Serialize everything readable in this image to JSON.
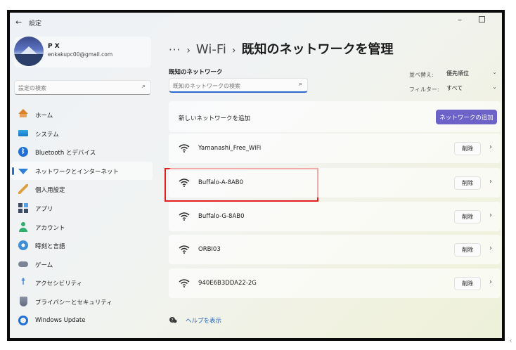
{
  "window": {
    "title": "設定",
    "back_icon": "back-arrow-icon"
  },
  "profile": {
    "name": "P X",
    "email": "enkakupc00@gmail.com"
  },
  "sidebar_search": {
    "placeholder": "設定の検索"
  },
  "nav": {
    "items": [
      {
        "label": "ホーム",
        "icon": "home-icon"
      },
      {
        "label": "システム",
        "icon": "system-icon"
      },
      {
        "label": "Bluetooth とデバイス",
        "icon": "bluetooth-icon"
      },
      {
        "label": "ネットワークとインターネット",
        "icon": "network-icon",
        "selected": true
      },
      {
        "label": "個人用設定",
        "icon": "brush-icon"
      },
      {
        "label": "アプリ",
        "icon": "apps-icon"
      },
      {
        "label": "アカウント",
        "icon": "account-icon"
      },
      {
        "label": "時刻と言語",
        "icon": "time-language-icon"
      },
      {
        "label": "ゲーム",
        "icon": "gaming-icon"
      },
      {
        "label": "アクセシビリティ",
        "icon": "accessibility-icon"
      },
      {
        "label": "プライバシーとセキュリティ",
        "icon": "privacy-shield-icon"
      },
      {
        "label": "Windows Update",
        "icon": "windows-update-icon"
      }
    ]
  },
  "breadcrumb": {
    "dots": "···",
    "parent": "Wi-Fi",
    "current": "既知のネットワークを管理"
  },
  "known_networks": {
    "section_title": "既知のネットワーク",
    "search_placeholder": "既知のネットワークの検索",
    "sort_label": "並べ替え:",
    "sort_value": "優先順位",
    "filter_label": "フィルター:",
    "filter_value": "すべて",
    "add_label": "新しいネットワークを追加",
    "add_button": "ネットワークの追加",
    "delete_label": "削除",
    "networks": [
      {
        "name": "Yamanashi_Free_WiFi"
      },
      {
        "name": "Buffalo-A-8AB0",
        "highlighted": true
      },
      {
        "name": "Buffalo-G-8AB0"
      },
      {
        "name": "ORBI03"
      },
      {
        "name": "940E6B3DDA22-2G"
      }
    ]
  },
  "help": {
    "label": "ヘルプを表示"
  },
  "colors": {
    "accent": "#6d62c8",
    "highlight": "#e02020",
    "selected_indicator": "#2b6bd0"
  }
}
